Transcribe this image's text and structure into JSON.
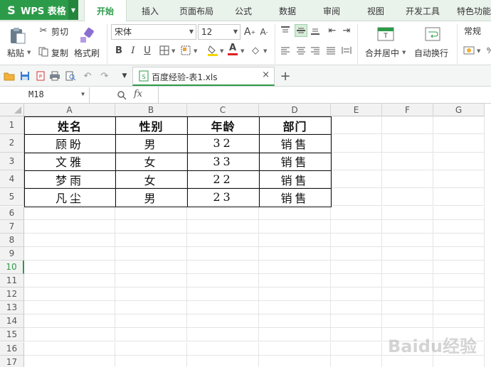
{
  "app": {
    "logo": "S",
    "name": "WPS 表格"
  },
  "tabs": [
    "开始",
    "插入",
    "页面布局",
    "公式",
    "数据",
    "审阅",
    "视图",
    "开发工具",
    "特色功能"
  ],
  "ribbon": {
    "paste": "粘贴",
    "cut": "剪切",
    "copy": "复制",
    "format_painter": "格式刷",
    "font_name": "宋体",
    "font_size": "12",
    "merge_center": "合并居中",
    "wrap_text": "自动换行",
    "number_format": "常规",
    "bold": "B",
    "italic": "I",
    "underline": "U",
    "font_color_letter": "A"
  },
  "document": {
    "tab_title": "百度经验-表1.xls"
  },
  "formula_bar": {
    "name_box": "M18",
    "fx": "fx",
    "formula": ""
  },
  "columns": [
    "A",
    "B",
    "C",
    "D",
    "E",
    "F",
    "G"
  ],
  "rows": [
    "1",
    "2",
    "3",
    "4",
    "5",
    "6",
    "7",
    "8",
    "9",
    "10",
    "11",
    "12",
    "13",
    "14",
    "15",
    "16",
    "17"
  ],
  "selected_row": "10",
  "table": {
    "headers": [
      "姓名",
      "性别",
      "年龄",
      "部门"
    ],
    "rows": [
      [
        "顾盼",
        "男",
        "32",
        "销售"
      ],
      [
        "文雅",
        "女",
        "33",
        "销售"
      ],
      [
        "梦雨",
        "女",
        "22",
        "销售"
      ],
      [
        "凡尘",
        "男",
        "23",
        "销售"
      ]
    ]
  },
  "watermark": "Baidu经验",
  "colors": {
    "accent": "#2c9b49",
    "menubar": "#eaf2ec"
  }
}
